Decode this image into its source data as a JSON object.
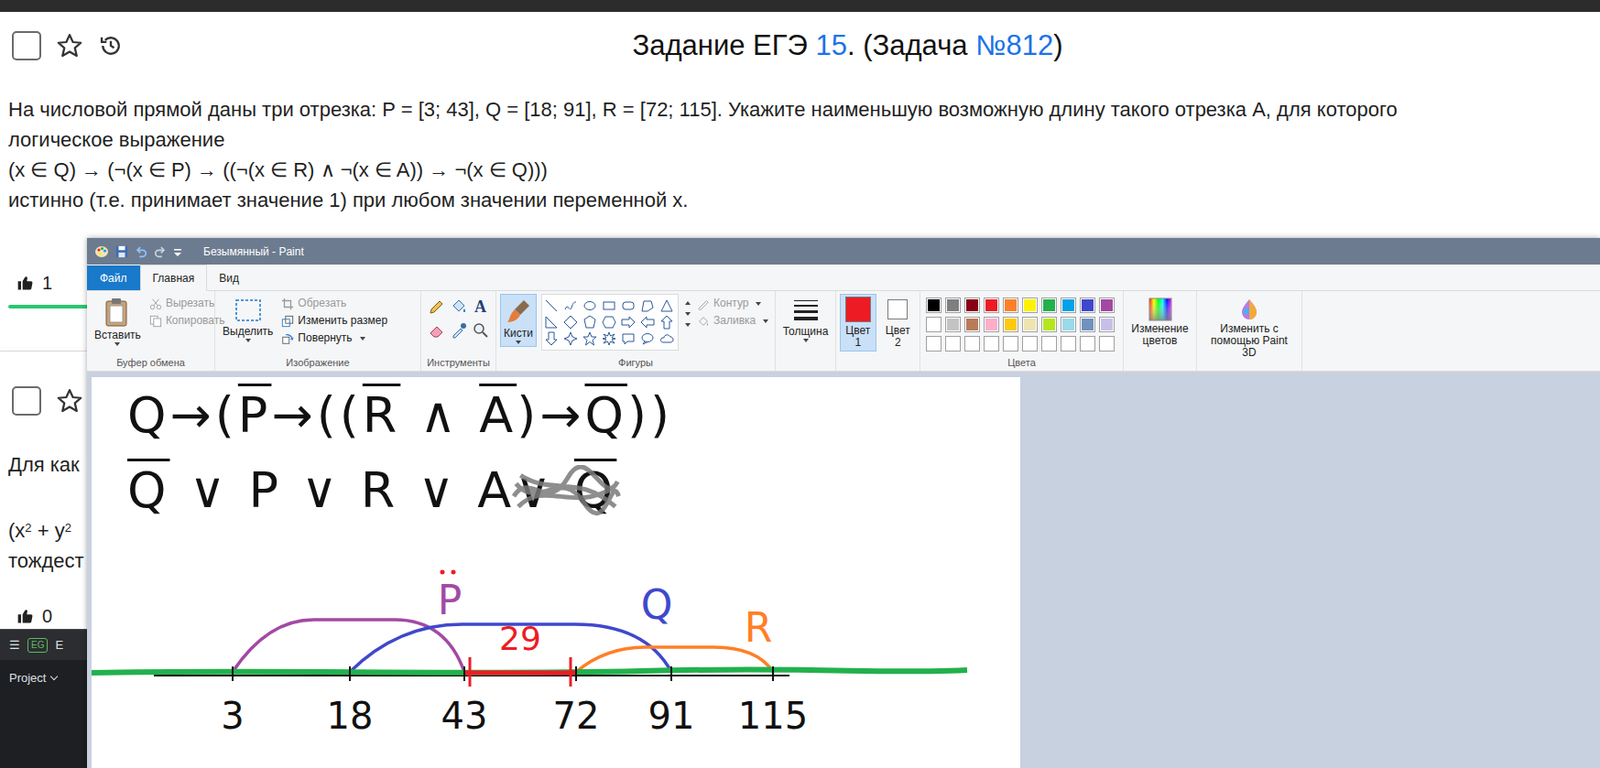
{
  "page": {
    "checked": false,
    "starred": false,
    "title": [
      {
        "text": "Задание ЕГЭ ",
        "link": false
      },
      {
        "text": "15",
        "link": true
      },
      {
        "text": ". (Задача ",
        "link": false
      },
      {
        "text": "№812",
        "link": true
      },
      {
        "text": ")",
        "link": false
      }
    ],
    "problem": [
      "На числовой прямой даны три отрезка: P = [3; 43], Q = [18; 91], R = [72; 115]. Укажите наименьшую возможную длину такого отрезка A, для которого",
      "логическое выражение",
      "(x ∈ Q) → (¬(x ∈ P) → ((¬(x ∈ R) ∧ ¬(x ∈ A)) → ¬(x ∈ Q)))",
      "истинно (т.е. принимает значение 1) при любом значении переменной x."
    ],
    "likes": "1"
  },
  "next_task": {
    "checked": false,
    "starred": false,
    "lines": [
      [
        {
          "text": "Для как",
          "sup": false
        }
      ],
      [
        {
          "text": "(x",
          "sup": false
        },
        {
          "text": "2",
          "sup": true
        },
        {
          "text": " + y",
          "sup": false
        },
        {
          "text": "2",
          "sup": true
        }
      ],
      [
        {
          "text": "тождест",
          "sup": false
        }
      ]
    ],
    "likes": "0"
  },
  "ide": {
    "menu": "☰",
    "badge": "EG",
    "name": "E",
    "project": "Project"
  },
  "paint": {
    "title": "Безымянный - Paint",
    "tabs": [
      {
        "label": "Файл",
        "selected": false,
        "kind": "file"
      },
      {
        "label": "Главная",
        "selected": true,
        "kind": "tab"
      },
      {
        "label": "Вид",
        "selected": false,
        "kind": "tab"
      }
    ],
    "clipboard": {
      "label": "Буфер обмена",
      "paste": "Вставить",
      "items": [
        {
          "label": "Вырезать",
          "disabled": true
        },
        {
          "label": "Копировать",
          "disabled": true
        }
      ]
    },
    "image": {
      "label": "Изображение",
      "select": "Выделить",
      "items": [
        {
          "label": "Обрезать",
          "disabled": true
        },
        {
          "label": "Изменить размер",
          "disabled": false
        },
        {
          "label": "Повернуть",
          "disabled": false
        }
      ]
    },
    "tools": {
      "label": "Инструменты",
      "text_tool": "A"
    },
    "shapes": {
      "label": "Фигуры",
      "brushes": {
        "label": "Кисти",
        "selected": true
      },
      "items": [
        {
          "label": "Контур",
          "disabled": true
        },
        {
          "label": "Заливка",
          "disabled": true
        }
      ]
    },
    "thickness": {
      "label": "Толщина"
    },
    "colors": [
      {
        "label": "Цвет",
        "num": "1",
        "color": "#ed1c24",
        "selected": true
      },
      {
        "label": "Цвет",
        "num": "2",
        "color": "#ffffff",
        "selected": false
      }
    ],
    "palette": {
      "label": "Цвета",
      "swatches": [
        {
          "kind": "color",
          "color": "#000000"
        },
        {
          "kind": "color",
          "color": "#7f7f7f"
        },
        {
          "kind": "color",
          "color": "#880015"
        },
        {
          "kind": "color",
          "color": "#ed1c24"
        },
        {
          "kind": "color",
          "color": "#ff7f27"
        },
        {
          "kind": "color",
          "color": "#fff200"
        },
        {
          "kind": "color",
          "color": "#22b14c"
        },
        {
          "kind": "color",
          "color": "#00a2e8"
        },
        {
          "kind": "color",
          "color": "#3f48cc"
        },
        {
          "kind": "color",
          "color": "#a349a4"
        },
        {
          "kind": "color",
          "color": "#ffffff"
        },
        {
          "kind": "color",
          "color": "#c3c3c3"
        },
        {
          "kind": "color",
          "color": "#b97a57"
        },
        {
          "kind": "color",
          "color": "#ffaec9"
        },
        {
          "kind": "color",
          "color": "#ffc90e"
        },
        {
          "kind": "color",
          "color": "#efe4b0"
        },
        {
          "kind": "color",
          "color": "#b5e61d"
        },
        {
          "kind": "color",
          "color": "#99d9ea"
        },
        {
          "kind": "color",
          "color": "#7092be"
        },
        {
          "kind": "color",
          "color": "#c8bfe7"
        },
        {
          "kind": "empty"
        },
        {
          "kind": "empty"
        },
        {
          "kind": "empty"
        },
        {
          "kind": "empty"
        },
        {
          "kind": "empty"
        },
        {
          "kind": "empty"
        },
        {
          "kind": "empty"
        },
        {
          "kind": "empty"
        },
        {
          "kind": "empty"
        },
        {
          "kind": "empty"
        }
      ]
    },
    "edit_colors": "Изменение цветов",
    "paint3d": "Изменить с помощью Paint 3D",
    "canvas": {
      "formula": [
        {
          "text": "Q",
          "bar": false
        },
        {
          "text": "→(",
          "bar": false
        },
        {
          "text": "P",
          "bar": true
        },
        {
          "text": "→((",
          "bar": false
        },
        {
          "text": "R",
          "bar": true
        },
        {
          "text": " ∧ ",
          "bar": false
        },
        {
          "text": "A",
          "bar": true
        },
        {
          "text": ")→",
          "bar": false
        },
        {
          "text": "Q",
          "bar": true
        },
        {
          "text": "))",
          "bar": false
        }
      ],
      "simplified": [
        {
          "text": "Q",
          "bar": true,
          "struck": false
        },
        {
          "text": " ∨ ",
          "bar": false,
          "struck": false
        },
        {
          "text": "P",
          "bar": false,
          "struck": false
        },
        {
          "text": " ∨ ",
          "bar": false,
          "struck": false
        },
        {
          "text": "R",
          "bar": false,
          "struck": false
        },
        {
          "text": " ∨ ",
          "bar": false,
          "struck": false
        },
        {
          "text": "A",
          "bar": false,
          "struck": false
        },
        {
          "text": " ∨ ",
          "bar": false,
          "struck": true
        },
        {
          "text": "Q",
          "bar": true,
          "struck": true
        }
      ],
      "ticks": [
        "3",
        "18",
        "43",
        "72",
        "91",
        "115"
      ],
      "segments": [
        {
          "name": "P",
          "from": "3",
          "to": "43",
          "color": "#a349a4"
        },
        {
          "name": "Q",
          "from": "18",
          "to": "91",
          "color": "#3f48cc"
        },
        {
          "name": "R",
          "from": "72",
          "to": "115",
          "color": "#ff7f27"
        }
      ],
      "answer": {
        "text": "29",
        "from": "43",
        "to": "72",
        "color": "#ed1c24"
      }
    }
  }
}
